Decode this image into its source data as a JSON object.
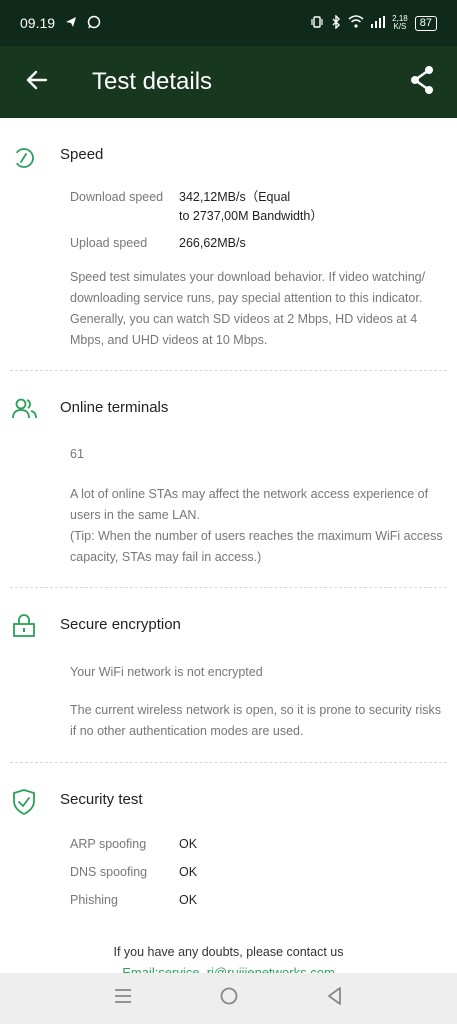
{
  "status_bar": {
    "time": "09.19",
    "net_speed_value": "2,18",
    "net_speed_unit": "K/S",
    "battery": "87"
  },
  "app_bar": {
    "title": "Test details"
  },
  "speed": {
    "title": "Speed",
    "download_label": "Download speed",
    "download_value_line1": "342,12MB/s（Equal",
    "download_value_line2": "to 2737,00M Bandwidth）",
    "upload_label": "Upload speed",
    "upload_value": "266,62MB/s",
    "description": "Speed test simulates your download behavior. If video watching/ downloading service runs, pay special attention to this indicator. Generally, you can watch SD videos at 2 Mbps, HD videos at 4 Mbps, and UHD videos at 10 Mbps."
  },
  "online_terminals": {
    "title": "Online terminals",
    "count": "61",
    "description": "A lot of online STAs may affect the network access experience of users in the same LAN.",
    "tip": "(Tip: When the number of users reaches the maximum WiFi access capacity, STAs may fail in access.)"
  },
  "secure_encryption": {
    "title": "Secure encryption",
    "status": "Your WiFi network is not encrypted",
    "description": "The current wireless network is open, so it is prone to security risks if no other authentication modes are used."
  },
  "security_test": {
    "title": "Security test",
    "items": [
      {
        "label": "ARP spoofing",
        "value": "OK"
      },
      {
        "label": "DNS spoofing",
        "value": "OK"
      },
      {
        "label": "Phishing",
        "value": "OK"
      }
    ]
  },
  "footer": {
    "contact_text": "If you have any doubts, please contact us",
    "email": "Email:service_ri@ruijienetworks.com"
  },
  "colors": {
    "accent": "#2aa15a",
    "app_bar": "#17371f",
    "status_bar": "#0f2a1b"
  },
  "icons": {
    "back": "arrow-left-icon",
    "share": "share-icon",
    "speed": "speedometer-icon",
    "terminals": "users-icon",
    "encryption": "lock-icon",
    "security": "shield-check-icon"
  }
}
